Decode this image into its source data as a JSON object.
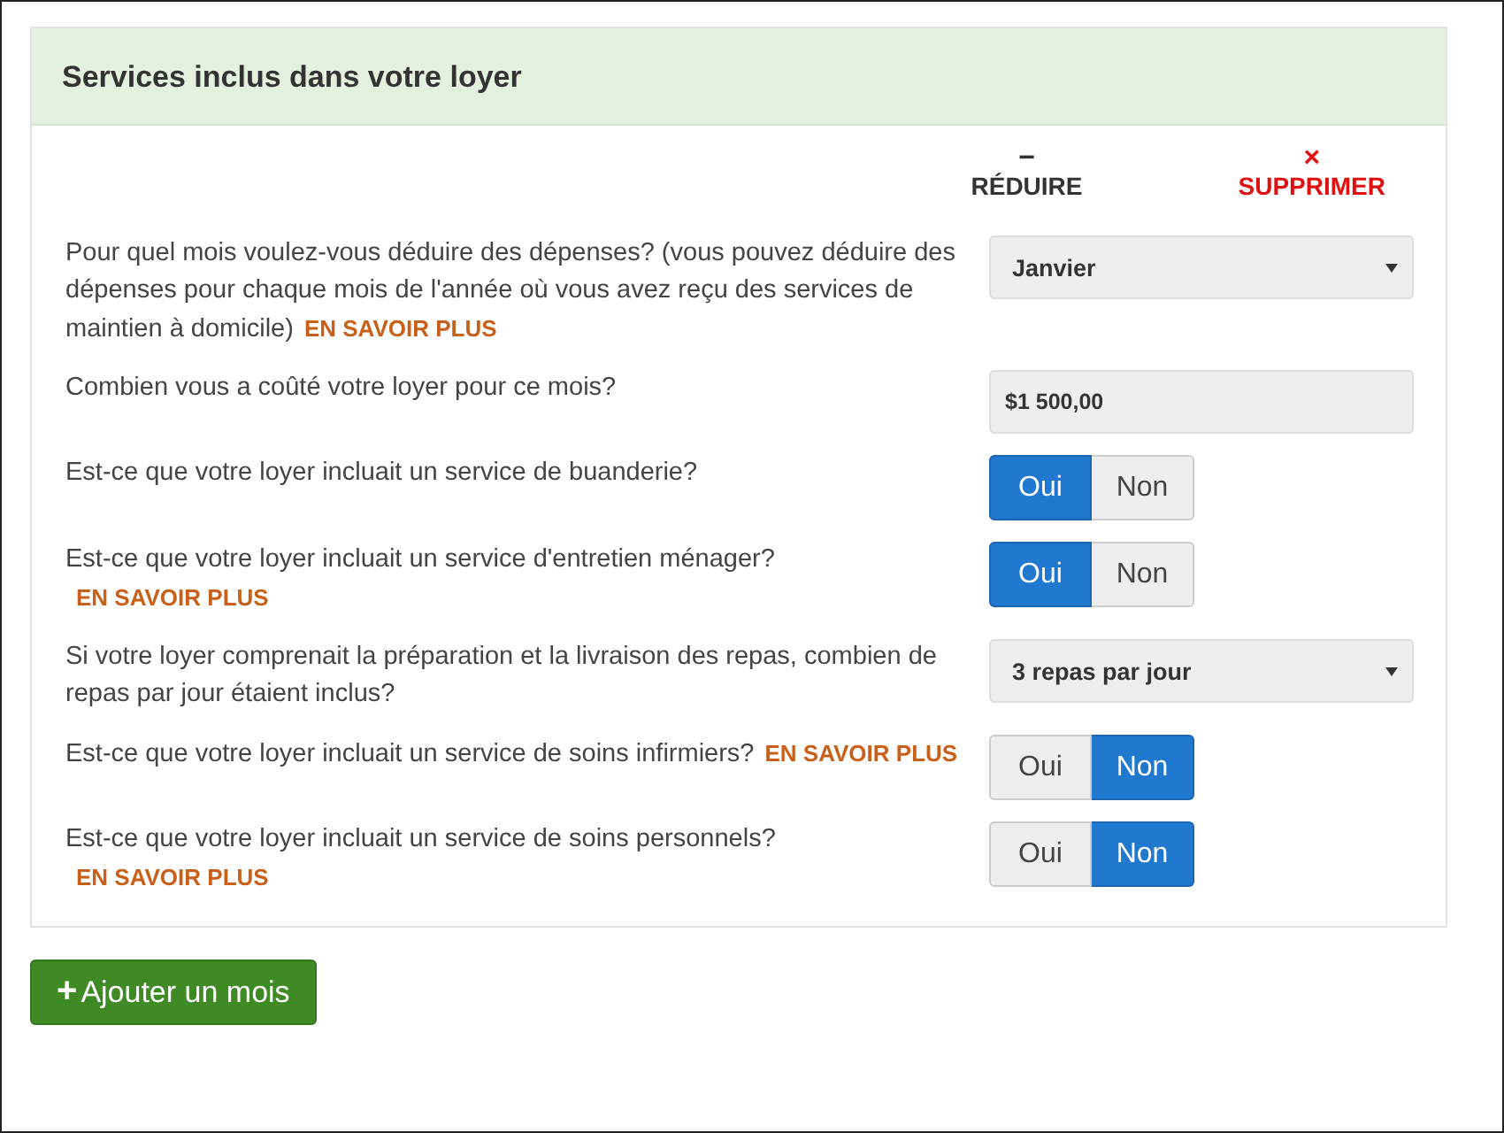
{
  "panel": {
    "title": "Services inclus dans votre loyer"
  },
  "actions": [
    {
      "kind": "collapse",
      "icon": "−",
      "label": "RÉDUIRE"
    },
    {
      "kind": "delete",
      "icon": "×",
      "label": "SUPPRIMER"
    }
  ],
  "questions": [
    {
      "kind": "select",
      "text": "Pour quel mois voulez-vous déduire des dépenses? (vous pouvez déduire des dépenses pour chaque mois de l'année où vous avez reçu des services de maintien à domicile)",
      "link": "EN SAVOIR PLUS",
      "value": "Janvier"
    },
    {
      "kind": "amount",
      "text": "Combien vous a coûté votre loyer pour ce mois?",
      "value": "$1 500,00"
    },
    {
      "kind": "toggle",
      "text": "Est-ce que votre loyer incluait un service de buanderie?",
      "options": [
        {
          "label": "Oui",
          "selected": true
        },
        {
          "label": "Non",
          "selected": false
        }
      ]
    },
    {
      "kind": "toggle",
      "text": "Est-ce que votre loyer incluait un service d'entretien ménager?",
      "link": "EN SAVOIR PLUS",
      "options": [
        {
          "label": "Oui",
          "selected": true
        },
        {
          "label": "Non",
          "selected": false
        }
      ]
    },
    {
      "kind": "select",
      "text": "Si votre loyer comprenait la préparation et la livraison des repas, combien de repas par jour étaient inclus?",
      "value": "3 repas par jour"
    },
    {
      "kind": "toggle",
      "text": "Est-ce que votre loyer incluait un service de soins infirmiers?",
      "link": "EN SAVOIR PLUS",
      "options": [
        {
          "label": "Oui",
          "selected": false
        },
        {
          "label": "Non",
          "selected": true
        }
      ]
    },
    {
      "kind": "toggle",
      "text": "Est-ce que votre loyer incluait un service de soins personnels?",
      "link": "EN SAVOIR PLUS",
      "options": [
        {
          "label": "Oui",
          "selected": false
        },
        {
          "label": "Non",
          "selected": true
        }
      ]
    }
  ],
  "add_button": {
    "icon": "+",
    "label": "Ajouter un mois"
  }
}
